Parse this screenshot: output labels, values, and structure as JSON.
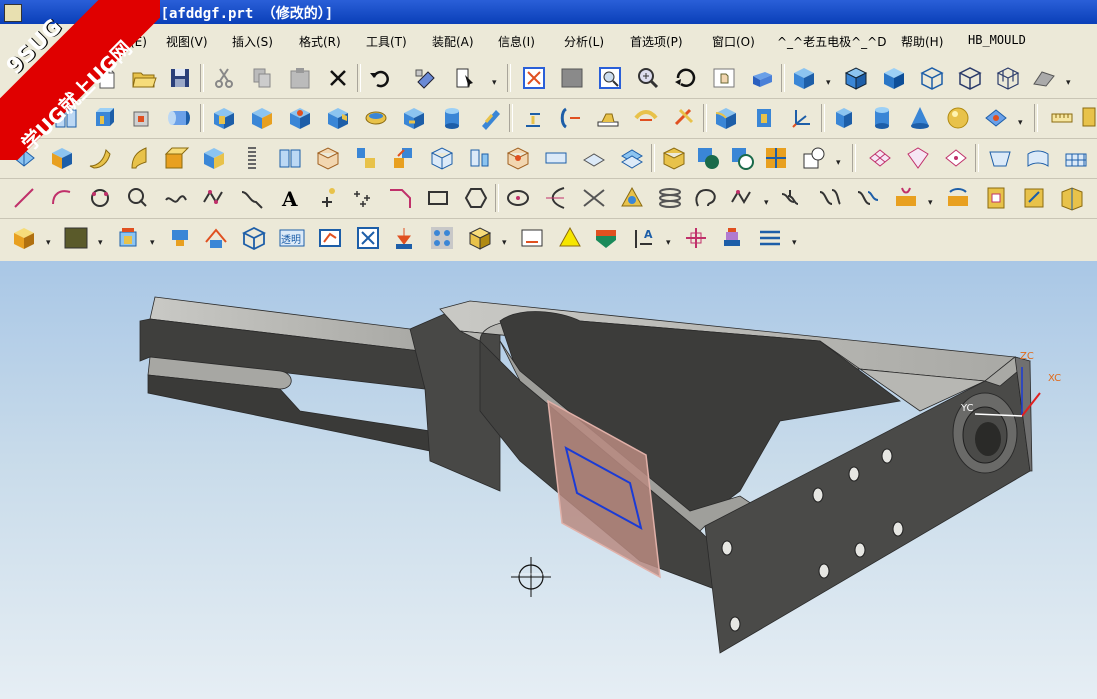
{
  "window": {
    "title": "ing - [afddgf.prt （修改的）]"
  },
  "menu": {
    "items": [
      {
        "label": "辑(E)"
      },
      {
        "label": "视图(V)"
      },
      {
        "label": "插入(S)"
      },
      {
        "label": "格式(R)"
      },
      {
        "label": "工具(T)"
      },
      {
        "label": "装配(A)"
      },
      {
        "label": "信息(I)"
      },
      {
        "label": "分析(L)"
      },
      {
        "label": "首选项(P)"
      },
      {
        "label": "窗口(O)"
      },
      {
        "label": "^_^老五电极^_^D"
      },
      {
        "label": "帮助(H)"
      },
      {
        "label": "HB_MOULD"
      }
    ]
  },
  "toolbar": {
    "text_tool_label": "A",
    "transparency_label": "透明"
  },
  "viewport": {
    "axes": {
      "zc": "ZC",
      "xc": "XC",
      "yc": "YC"
    },
    "colors": {
      "axis_z": "#e06a1a",
      "axis_x": "#e06a1a",
      "axis_y": "#ffffff",
      "part": "#4a4a48",
      "sketch_plane": "#b98a80",
      "sketch_profile": "#1a3bd6"
    }
  },
  "watermark": {
    "line1": "9SUG",
    "line2": "学UG就上UG网"
  }
}
